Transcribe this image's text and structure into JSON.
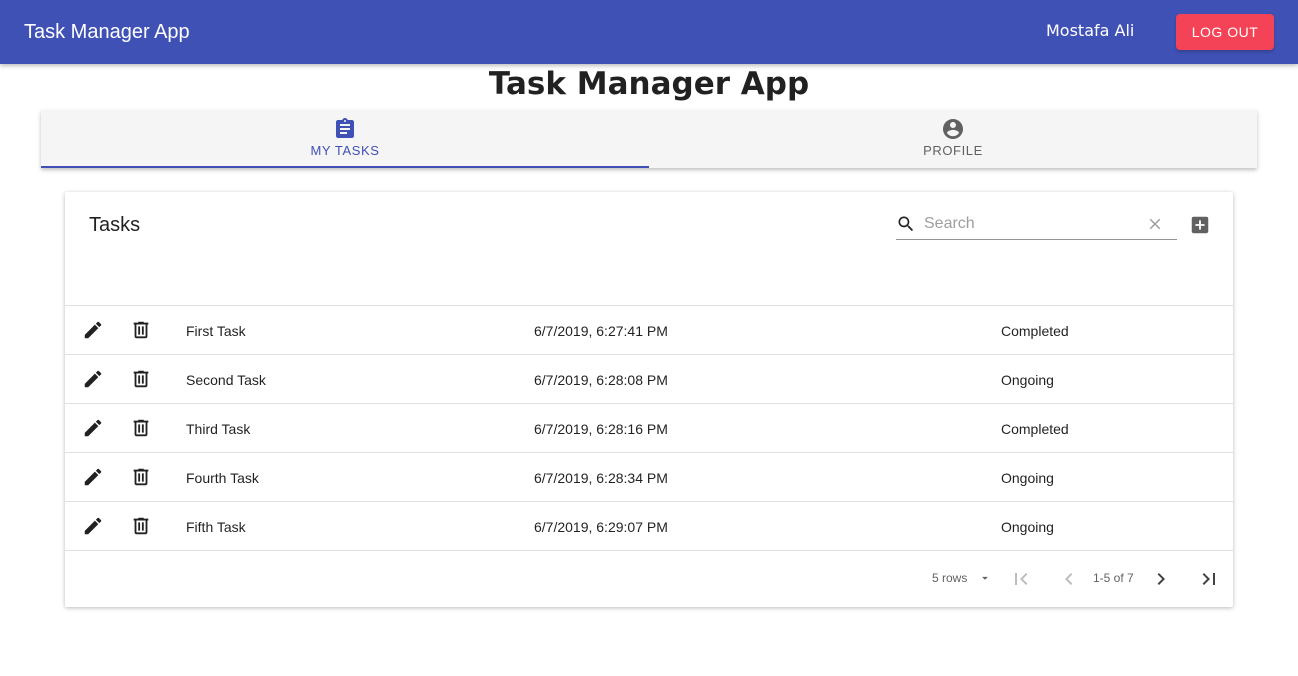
{
  "appbar": {
    "title": "Task Manager App",
    "user_name": "Mostafa Ali",
    "logout_label": "LOG OUT"
  },
  "page_title": "Task Manager App",
  "tabs": [
    {
      "label": "MY TASKS",
      "icon": "assignment-icon",
      "active": true
    },
    {
      "label": "PROFILE",
      "icon": "account-circle-icon",
      "active": false
    }
  ],
  "tasks_card": {
    "title": "Tasks",
    "search": {
      "placeholder": "Search",
      "value": ""
    },
    "rows": [
      {
        "name": "First Task",
        "date": "6/7/2019, 6:27:41 PM",
        "status": "Completed"
      },
      {
        "name": "Second Task",
        "date": "6/7/2019, 6:28:08 PM",
        "status": "Ongoing"
      },
      {
        "name": "Third Task",
        "date": "6/7/2019, 6:28:16 PM",
        "status": "Completed"
      },
      {
        "name": "Fourth Task",
        "date": "6/7/2019, 6:28:34 PM",
        "status": "Ongoing"
      },
      {
        "name": "Fifth Task",
        "date": "6/7/2019, 6:29:07 PM",
        "status": "Ongoing"
      }
    ],
    "pagination": {
      "rows_per_page": "5 rows",
      "range": "1-5 of 7"
    }
  },
  "colors": {
    "primary": "#3f51b5",
    "logout": "#f44256",
    "tab_bg": "#f5f5f5"
  }
}
